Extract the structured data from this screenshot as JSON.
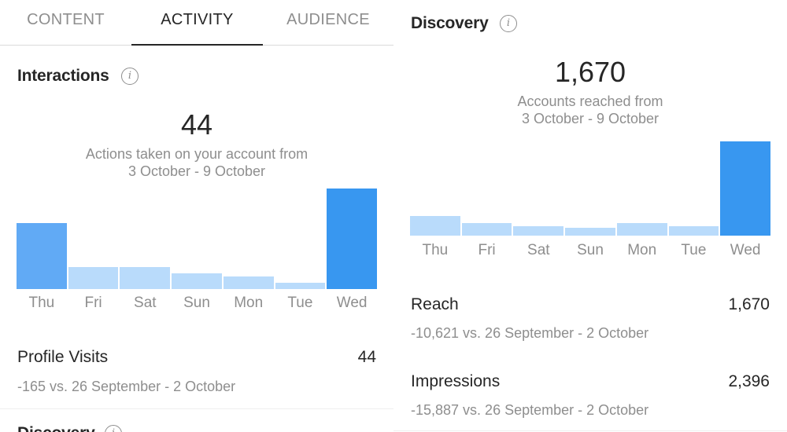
{
  "tabs": [
    {
      "label": "CONTENT",
      "active": false
    },
    {
      "label": "ACTIVITY",
      "active": true
    },
    {
      "label": "AUDIENCE",
      "active": false
    }
  ],
  "interactions": {
    "title": "Interactions",
    "info_icon": "info-icon",
    "total": "44",
    "subtitle_line1": "Actions taken on your account from",
    "subtitle_line2": "3 October - 9 October",
    "chart_data": {
      "type": "bar",
      "categories": [
        "Thu",
        "Fri",
        "Sat",
        "Sun",
        "Mon",
        "Tue",
        "Wed"
      ],
      "values": [
        21,
        7,
        7,
        5,
        4,
        2,
        32
      ],
      "colors": [
        "#61aaf5",
        "#b9dbfb",
        "#b9dbfb",
        "#b9dbfb",
        "#b9dbfb",
        "#b9dbfb",
        "#3897f0"
      ]
    },
    "metrics": [
      {
        "name": "Profile Visits",
        "value": "44",
        "compare": "-165 vs. 26 September - 2 October"
      }
    ],
    "next_section_partial": "Discovery"
  },
  "discovery": {
    "title": "Discovery",
    "info_icon": "info-icon",
    "total": "1,670",
    "subtitle_line1": "Accounts reached from",
    "subtitle_line2": "3 October - 9 October",
    "chart_data": {
      "type": "bar",
      "categories": [
        "Thu",
        "Fri",
        "Sat",
        "Sun",
        "Mon",
        "Tue",
        "Wed"
      ],
      "values": [
        190,
        120,
        95,
        80,
        120,
        90,
        920
      ],
      "colors": [
        "#b9dbfb",
        "#b9dbfb",
        "#b9dbfb",
        "#b9dbfb",
        "#b9dbfb",
        "#b9dbfb",
        "#3897f0"
      ]
    },
    "metrics": [
      {
        "name": "Reach",
        "value": "1,670",
        "compare": "-10,621 vs. 26 September - 2 October"
      },
      {
        "name": "Impressions",
        "value": "2,396",
        "compare": "-15,887 vs. 26 September - 2 October"
      }
    ]
  }
}
